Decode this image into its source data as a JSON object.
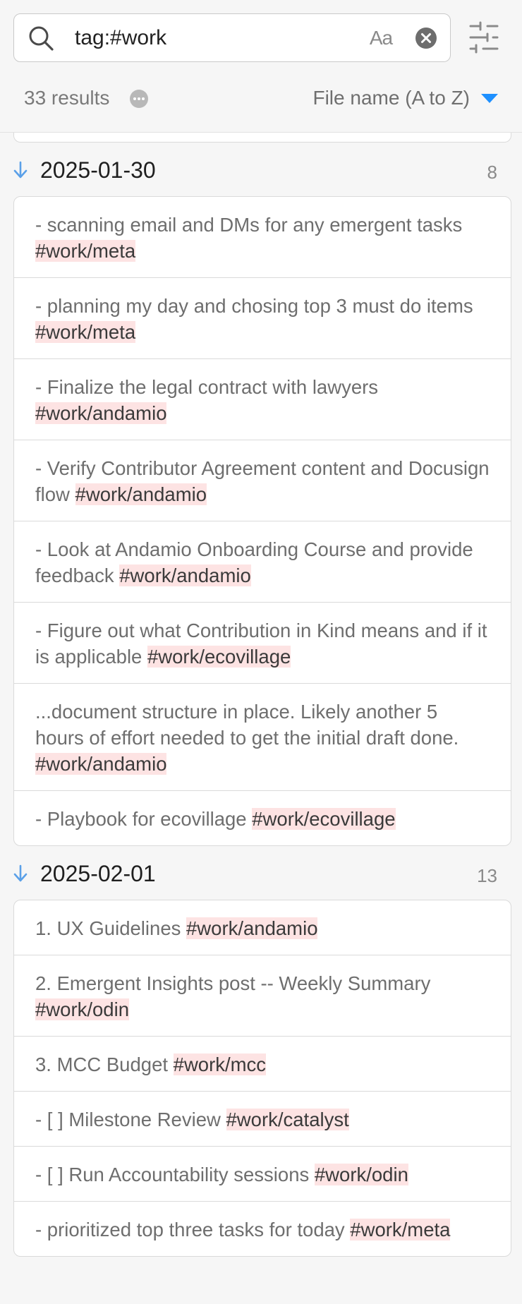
{
  "search": {
    "query": "tag:#work",
    "match_case_label": "Aa"
  },
  "results": {
    "count_label": "33 results",
    "sort_label": "File name (A to Z)"
  },
  "groups": [
    {
      "title": "2025-01-30",
      "count": "8",
      "matches": [
        {
          "text": "- scanning email and DMs for any emergent tasks ",
          "tag": "#work/meta"
        },
        {
          "text": "- planning my day and chosing top 3 must do items ",
          "tag": "#work/meta"
        },
        {
          "text": "- Finalize the legal contract with lawyers ",
          "tag": "#work/andamio"
        },
        {
          "text": "- Verify Contributor Agreement content and Docusign flow ",
          "tag": "#work/andamio"
        },
        {
          "text": "- Look at Andamio Onboarding Course and provide feedback ",
          "tag": "#work/andamio"
        },
        {
          "text": "- Figure out what Contribution in Kind means and if it is applicable ",
          "tag": "#work/ecovillage"
        },
        {
          "text": "...document structure in place. Likely another 5 hours of effort needed to get the initial draft done. ",
          "tag": "#work/andamio"
        },
        {
          "text": "- Playbook for ecovillage ",
          "tag": "#work/ecovillage"
        }
      ]
    },
    {
      "title": "2025-02-01",
      "count": "13",
      "matches": [
        {
          "text": "1. UX Guidelines ",
          "tag": "#work/andamio"
        },
        {
          "text": "2. Emergent Insights post -- Weekly Summary ",
          "tag": "#work/odin"
        },
        {
          "text": "3. MCC Budget ",
          "tag": "#work/mcc"
        },
        {
          "text": "- [ ] Milestone Review ",
          "tag": "#work/catalyst"
        },
        {
          "text": "- [ ] Run Accountability sessions ",
          "tag": "#work/odin"
        },
        {
          "text": "- prioritized top three tasks for today ",
          "tag": "#work/meta"
        }
      ]
    }
  ],
  "colors": {
    "accent_blue": "#1e90ff",
    "highlight_bg": "#fde3e3",
    "muted_text": "#6e6e6e"
  },
  "icons": {
    "search": "search-icon",
    "clear": "clear-search-icon",
    "settings": "sliders-icon",
    "more": "more-options-icon",
    "sort": "chevron-down-icon",
    "collapse": "arrow-down-icon"
  }
}
